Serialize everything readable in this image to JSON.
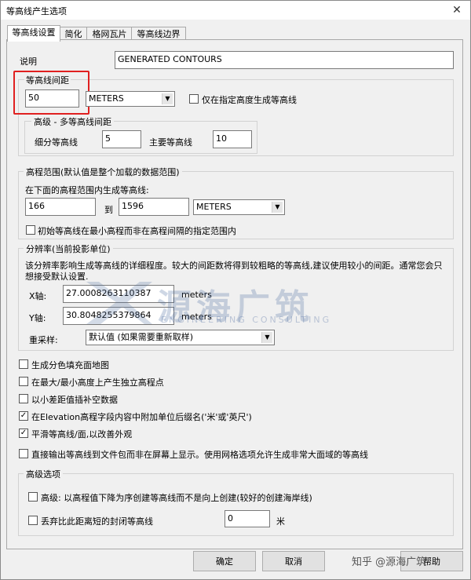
{
  "window": {
    "title": "等高线产生选项"
  },
  "tabs": [
    {
      "label": "等高线设置"
    },
    {
      "label": "简化"
    },
    {
      "label": "格网瓦片"
    },
    {
      "label": "等高线边界"
    }
  ],
  "description": {
    "label": "说明",
    "value": "GENERATED CONTOURS"
  },
  "interval": {
    "group_title": "等高线间距",
    "value": "50",
    "unit": "METERS",
    "only_specified_label": "仅在指定高度生成等高线",
    "only_specified_checked": false,
    "advanced": {
      "title": "高级 - 多等高线间距",
      "minor_label": "细分等高线",
      "minor_value": "5",
      "major_label": "主要等高线",
      "major_value": "10"
    }
  },
  "elevation_range": {
    "group_title": "高程范围(默认值是整个加载的数据范围)",
    "hint": "在下面的高程范围内生成等高线:",
    "from": "166",
    "to_label": "到",
    "to": "1596",
    "unit": "METERS",
    "start_at_min_label": "初始等高线在最小高程而非在高程间隔的指定范围内",
    "start_at_min_checked": false
  },
  "resolution": {
    "group_title": "分辨率(当前投影单位)",
    "desc_line1": "该分辨率影响生成等高线的详细程度。较大的间距数将得到较粗略的等高线,建议使用较小的间距。通常您会只",
    "desc_line2": "想接受默认设置.",
    "x_label": "X轴:",
    "x_value": "27.0008263110387",
    "x_unit": "meters",
    "y_label": "Y轴:",
    "y_value": "30.8048255379864",
    "y_unit": "meters",
    "resample_label": "重采样:",
    "resample_value": "默认值 (如果需要重新取样)"
  },
  "options": [
    {
      "label": "生成分色填充面地图",
      "checked": false
    },
    {
      "label": "在最大/最小高度上产生独立高程点",
      "checked": false
    },
    {
      "label": "以小差距值插补空数据",
      "checked": false
    },
    {
      "label": "在Elevation高程字段内容中附加单位后缀名('米'或'英尺')",
      "checked": true
    },
    {
      "label": "平滑等高线/面,以改善外观",
      "checked": true
    },
    {
      "label": "直接输出等高线到文件包而非在屏幕上显示。使用网格选项允许生成非常大面域的等高线",
      "checked": false
    }
  ],
  "advanced_options": {
    "group_title": "高级选项",
    "descending_label": "高级: 以高程值下降为序创建等高线而不是向上创建(较好的创建海岸线)",
    "descending_checked": false,
    "discard_label": "丢弃比此距离短的封闭等高线",
    "discard_checked": false,
    "discard_value": "0",
    "discard_unit": "米"
  },
  "buttons": {
    "ok": "确定",
    "cancel": "取消",
    "help": "帮助"
  },
  "watermark": {
    "main": "源海广筑",
    "sub": "ENGINEERING CONSULTING",
    "corner": "知乎 @源海广筑"
  },
  "colors": {
    "highlight": "#e02020",
    "watermark": "#506ea0"
  }
}
